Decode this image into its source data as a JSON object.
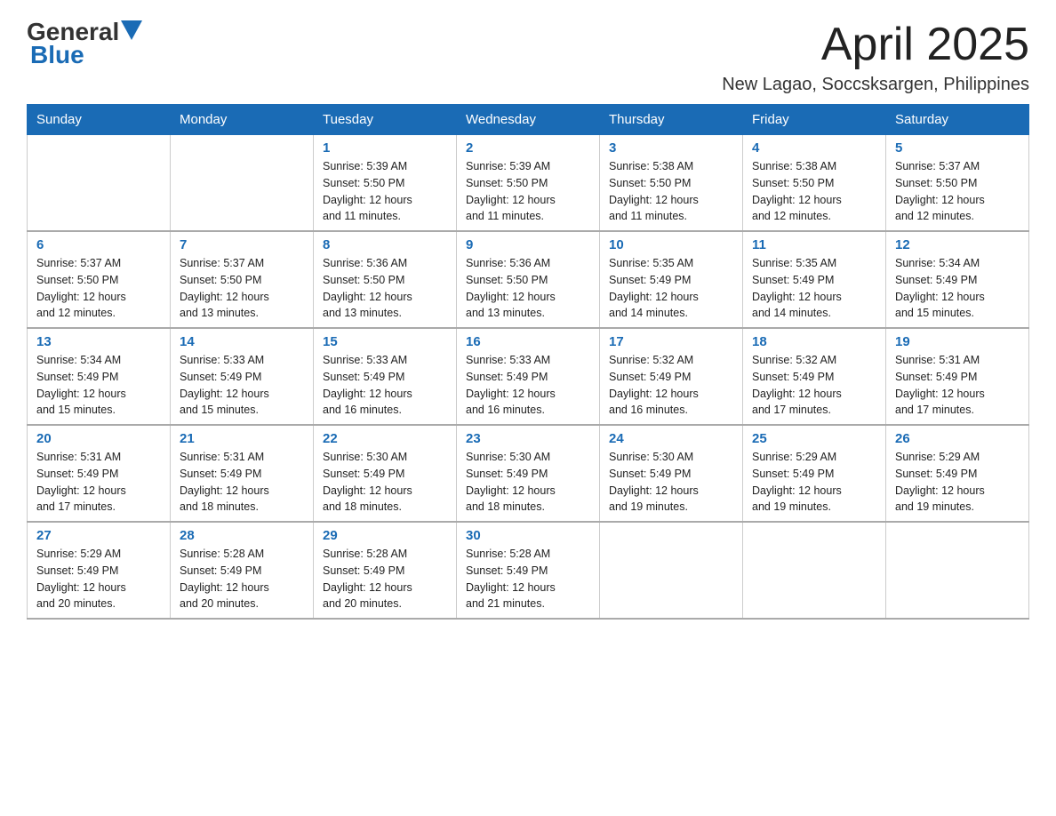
{
  "logo": {
    "general": "General",
    "blue": "Blue"
  },
  "title": "April 2025",
  "location": "New Lagao, Soccsksargen, Philippines",
  "days_of_week": [
    "Sunday",
    "Monday",
    "Tuesday",
    "Wednesday",
    "Thursday",
    "Friday",
    "Saturday"
  ],
  "weeks": [
    [
      {
        "day": "",
        "info": ""
      },
      {
        "day": "",
        "info": ""
      },
      {
        "day": "1",
        "info": "Sunrise: 5:39 AM\nSunset: 5:50 PM\nDaylight: 12 hours\nand 11 minutes."
      },
      {
        "day": "2",
        "info": "Sunrise: 5:39 AM\nSunset: 5:50 PM\nDaylight: 12 hours\nand 11 minutes."
      },
      {
        "day": "3",
        "info": "Sunrise: 5:38 AM\nSunset: 5:50 PM\nDaylight: 12 hours\nand 11 minutes."
      },
      {
        "day": "4",
        "info": "Sunrise: 5:38 AM\nSunset: 5:50 PM\nDaylight: 12 hours\nand 12 minutes."
      },
      {
        "day": "5",
        "info": "Sunrise: 5:37 AM\nSunset: 5:50 PM\nDaylight: 12 hours\nand 12 minutes."
      }
    ],
    [
      {
        "day": "6",
        "info": "Sunrise: 5:37 AM\nSunset: 5:50 PM\nDaylight: 12 hours\nand 12 minutes."
      },
      {
        "day": "7",
        "info": "Sunrise: 5:37 AM\nSunset: 5:50 PM\nDaylight: 12 hours\nand 13 minutes."
      },
      {
        "day": "8",
        "info": "Sunrise: 5:36 AM\nSunset: 5:50 PM\nDaylight: 12 hours\nand 13 minutes."
      },
      {
        "day": "9",
        "info": "Sunrise: 5:36 AM\nSunset: 5:50 PM\nDaylight: 12 hours\nand 13 minutes."
      },
      {
        "day": "10",
        "info": "Sunrise: 5:35 AM\nSunset: 5:49 PM\nDaylight: 12 hours\nand 14 minutes."
      },
      {
        "day": "11",
        "info": "Sunrise: 5:35 AM\nSunset: 5:49 PM\nDaylight: 12 hours\nand 14 minutes."
      },
      {
        "day": "12",
        "info": "Sunrise: 5:34 AM\nSunset: 5:49 PM\nDaylight: 12 hours\nand 15 minutes."
      }
    ],
    [
      {
        "day": "13",
        "info": "Sunrise: 5:34 AM\nSunset: 5:49 PM\nDaylight: 12 hours\nand 15 minutes."
      },
      {
        "day": "14",
        "info": "Sunrise: 5:33 AM\nSunset: 5:49 PM\nDaylight: 12 hours\nand 15 minutes."
      },
      {
        "day": "15",
        "info": "Sunrise: 5:33 AM\nSunset: 5:49 PM\nDaylight: 12 hours\nand 16 minutes."
      },
      {
        "day": "16",
        "info": "Sunrise: 5:33 AM\nSunset: 5:49 PM\nDaylight: 12 hours\nand 16 minutes."
      },
      {
        "day": "17",
        "info": "Sunrise: 5:32 AM\nSunset: 5:49 PM\nDaylight: 12 hours\nand 16 minutes."
      },
      {
        "day": "18",
        "info": "Sunrise: 5:32 AM\nSunset: 5:49 PM\nDaylight: 12 hours\nand 17 minutes."
      },
      {
        "day": "19",
        "info": "Sunrise: 5:31 AM\nSunset: 5:49 PM\nDaylight: 12 hours\nand 17 minutes."
      }
    ],
    [
      {
        "day": "20",
        "info": "Sunrise: 5:31 AM\nSunset: 5:49 PM\nDaylight: 12 hours\nand 17 minutes."
      },
      {
        "day": "21",
        "info": "Sunrise: 5:31 AM\nSunset: 5:49 PM\nDaylight: 12 hours\nand 18 minutes."
      },
      {
        "day": "22",
        "info": "Sunrise: 5:30 AM\nSunset: 5:49 PM\nDaylight: 12 hours\nand 18 minutes."
      },
      {
        "day": "23",
        "info": "Sunrise: 5:30 AM\nSunset: 5:49 PM\nDaylight: 12 hours\nand 18 minutes."
      },
      {
        "day": "24",
        "info": "Sunrise: 5:30 AM\nSunset: 5:49 PM\nDaylight: 12 hours\nand 19 minutes."
      },
      {
        "day": "25",
        "info": "Sunrise: 5:29 AM\nSunset: 5:49 PM\nDaylight: 12 hours\nand 19 minutes."
      },
      {
        "day": "26",
        "info": "Sunrise: 5:29 AM\nSunset: 5:49 PM\nDaylight: 12 hours\nand 19 minutes."
      }
    ],
    [
      {
        "day": "27",
        "info": "Sunrise: 5:29 AM\nSunset: 5:49 PM\nDaylight: 12 hours\nand 20 minutes."
      },
      {
        "day": "28",
        "info": "Sunrise: 5:28 AM\nSunset: 5:49 PM\nDaylight: 12 hours\nand 20 minutes."
      },
      {
        "day": "29",
        "info": "Sunrise: 5:28 AM\nSunset: 5:49 PM\nDaylight: 12 hours\nand 20 minutes."
      },
      {
        "day": "30",
        "info": "Sunrise: 5:28 AM\nSunset: 5:49 PM\nDaylight: 12 hours\nand 21 minutes."
      },
      {
        "day": "",
        "info": ""
      },
      {
        "day": "",
        "info": ""
      },
      {
        "day": "",
        "info": ""
      }
    ]
  ]
}
